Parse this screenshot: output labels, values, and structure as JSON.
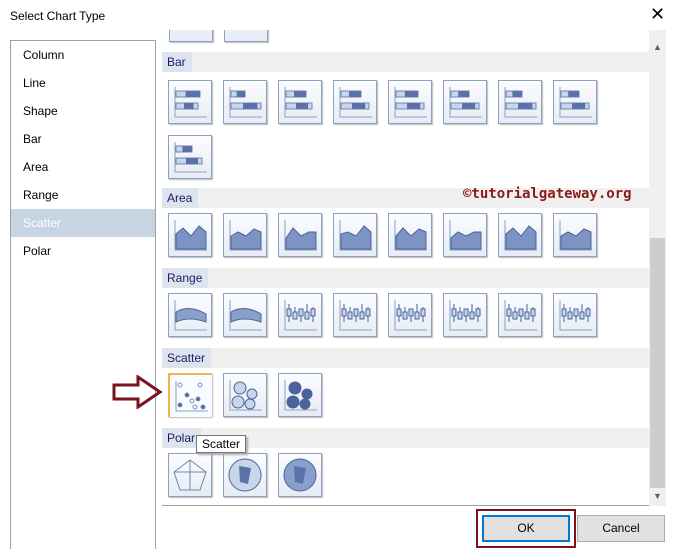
{
  "dialog": {
    "title": "Select Chart Type",
    "close": "✕"
  },
  "sidebar": {
    "items": [
      {
        "label": "Column"
      },
      {
        "label": "Line"
      },
      {
        "label": "Shape"
      },
      {
        "label": "Bar"
      },
      {
        "label": "Area"
      },
      {
        "label": "Range"
      },
      {
        "label": "Scatter"
      },
      {
        "label": "Polar"
      }
    ],
    "selected": "Scatter"
  },
  "sections": {
    "bar": "Bar",
    "area": "Area",
    "range": "Range",
    "scatter": "Scatter",
    "polar": "Polar"
  },
  "watermark": "©tutorialgateway.org",
  "tooltip": "Scatter",
  "buttons": {
    "ok": "OK",
    "cancel": "Cancel"
  },
  "colors": {
    "accent": "#0078d7",
    "annotation": "#7a1020",
    "selected_icon": "#f0b44d"
  }
}
